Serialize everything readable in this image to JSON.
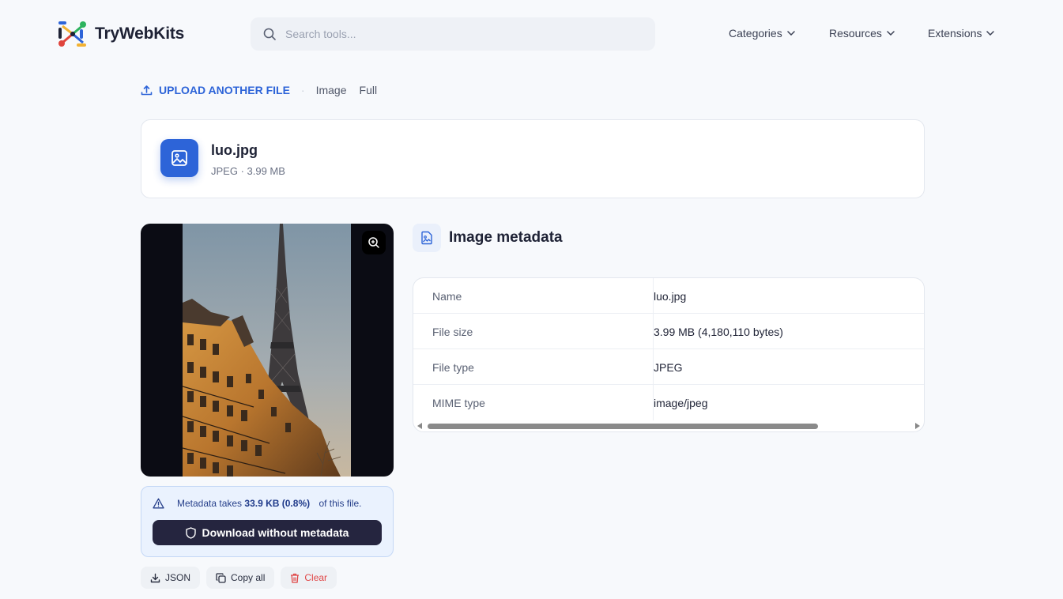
{
  "header": {
    "logo_text": "TryWebKits",
    "search_placeholder": "Search tools...",
    "nav": [
      {
        "label": "Categories"
      },
      {
        "label": "Resources"
      },
      {
        "label": "Extensions"
      }
    ]
  },
  "breadcrumb": {
    "upload_label": "UPLOAD ANOTHER FILE",
    "separator": "·",
    "items": [
      "Image",
      "Full"
    ]
  },
  "file": {
    "name": "luo.jpg",
    "meta": "JPEG · 3.99 MB"
  },
  "notice": {
    "prefix": "Metadata takes",
    "amount": "33.9 KB (0.8%)",
    "suffix": "of this file.",
    "download_label": "Download without metadata"
  },
  "actions": {
    "json_label": "JSON",
    "copy_label": "Copy all",
    "clear_label": "Clear"
  },
  "metadata": {
    "title": "Image metadata",
    "rows": [
      {
        "key": "Name",
        "value": "luo.jpg"
      },
      {
        "key": "File size",
        "value": "3.99 MB (4,180,110 bytes)"
      },
      {
        "key": "File type",
        "value": "JPEG"
      },
      {
        "key": "MIME type",
        "value": "image/jpeg"
      }
    ]
  },
  "colors": {
    "accent": "#2d64d8",
    "dark_button": "#25253f",
    "danger": "#e04646",
    "notice_bg": "#eaf2fe"
  },
  "icons": {
    "search": "search-icon",
    "upload": "upload-icon",
    "file": "image-file-icon",
    "zoom": "zoom-in-icon",
    "warning": "warning-triangle-icon",
    "shield": "shield-icon",
    "download": "download-icon",
    "copy": "copy-icon",
    "trash": "trash-icon"
  }
}
